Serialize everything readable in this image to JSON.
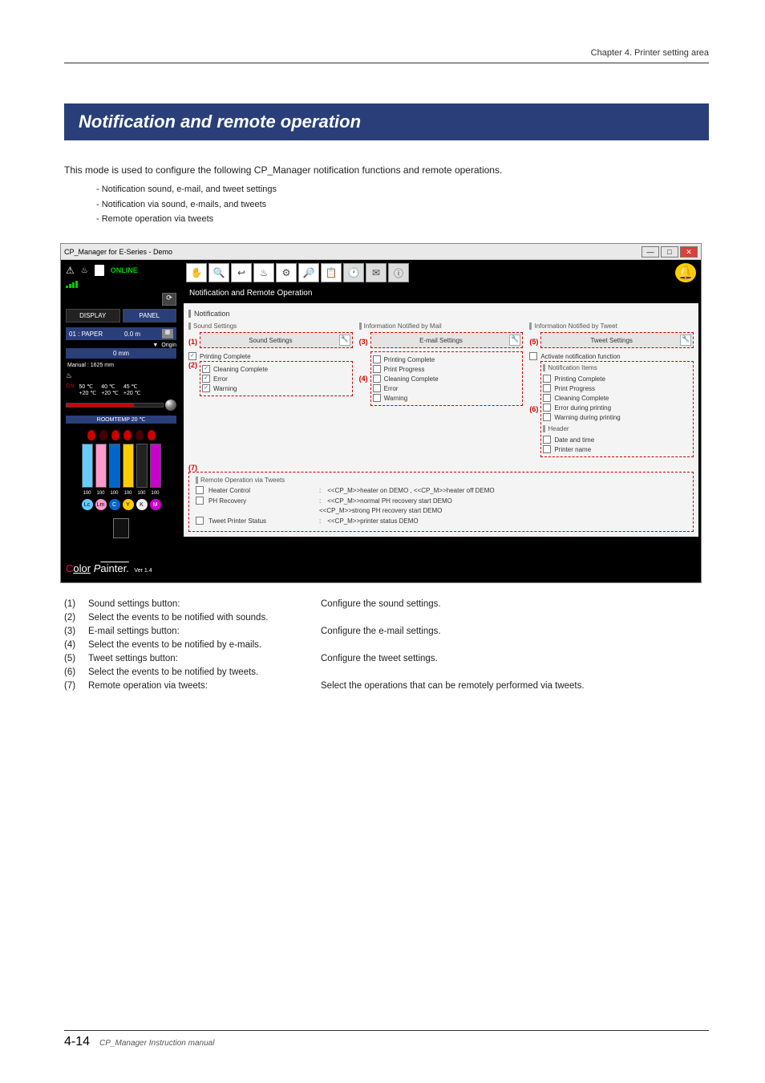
{
  "chapter": "Chapter 4. Printer setting area",
  "title": "Notification and remote operation",
  "intro": "This mode is used to configure the following CP_Manager notification functions and remote operations.",
  "bullets": {
    "b1": "- Notification sound, e-mail, and tweet settings",
    "b2": "- Notification via sound, e-mails, and tweets",
    "b3": "- Remote operation via tweets"
  },
  "win": {
    "title": "CP_Manager for E-Series - Demo",
    "online": "ONLINE",
    "tabs": {
      "display": "DISPLAY",
      "panel": "PANEL"
    },
    "status": {
      "paper_label": "01 : PAPER",
      "paper_val": "0.0 m",
      "origin": "Origin",
      "origin_val": "0 mm",
      "manual": "Manual : 1625 mm"
    },
    "heaters": {
      "on": "ON",
      "h1a": "50 ℃",
      "h1b": "+20 ℃",
      "h2a": "40 ℃",
      "h2b": "+20 ℃",
      "h3a": "45 ℃",
      "h3b": "+20 ℃"
    },
    "roomtemp": "ROOMTEMP  20 ℃",
    "inklevels": [
      "100",
      "100",
      "100",
      "100",
      "100",
      "100"
    ],
    "inkletters": [
      "Lc",
      "Lm",
      "C",
      "Y",
      "K",
      "M"
    ],
    "logo": "Color Painter.",
    "ver": "Ver 1.4"
  },
  "main": {
    "mode_title": "Notification and Remote Operation",
    "notif_hdr": "Notification",
    "sound_hdr": "Sound Settings",
    "sound_btn": "Sound Settings",
    "mail_hdr": "Information Notified by Mail",
    "mail_btn": "E-mail Settings",
    "tweet_hdr": "Information Notified by Tweet",
    "tweet_btn": "Tweet Settings",
    "act_notif": "Activate notification function",
    "notif_items_hdr": "Notification Items",
    "items": {
      "print_complete": "Printing Complete",
      "print_progress": "Print Progress",
      "clean_complete": "Cleaning Complete",
      "error": "Error",
      "warning": "Warning",
      "err_during": "Error during printing",
      "warn_during": "Warning during printing"
    },
    "header_hdr": "Header",
    "date_time": "Date and time",
    "printer_name": "Printer name",
    "remote_hdr": "Remote Operation via Tweets",
    "remote": {
      "heater": "Heater Control",
      "heater_cmd": "<<CP_M>>heater on DEMO , <<CP_M>>heater off DEMO",
      "ph": "PH Recovery",
      "ph1": "<<CP_M>>normal PH recovery start DEMO",
      "ph2": "<<CP_M>>strong PH recovery start DEMO",
      "status": "Tweet Printer Status",
      "status_cmd": "<<CP_M>>printer status DEMO"
    },
    "nums": {
      "n1": "(1)",
      "n2": "(2)",
      "n3": "(3)",
      "n4": "(4)",
      "n5": "(5)",
      "n6": "(6)",
      "n7": "(7)"
    }
  },
  "legend": {
    "r1": {
      "n": "(1)",
      "l": "Sound settings button:",
      "d": "Configure the sound settings."
    },
    "r2": {
      "n": "(2)",
      "l": "Select the events to be notified with sounds.",
      "d": ""
    },
    "r3": {
      "n": "(3)",
      "l": "E-mail settings button:",
      "d": "Configure the e-mail settings."
    },
    "r4": {
      "n": "(4)",
      "l": "Select the events to be notified by e-mails.",
      "d": ""
    },
    "r5": {
      "n": "(5)",
      "l": "Tweet settings button:",
      "d": "Configure the tweet settings."
    },
    "r6": {
      "n": "(6)",
      "l": "Select the events to be notified by tweets.",
      "d": ""
    },
    "r7": {
      "n": "(7)",
      "l": "Remote operation via tweets:",
      "d": "Select the operations that can be remotely performed via tweets."
    }
  },
  "footer": {
    "page": "4-14",
    "doc": "CP_Manager Instruction manual"
  }
}
